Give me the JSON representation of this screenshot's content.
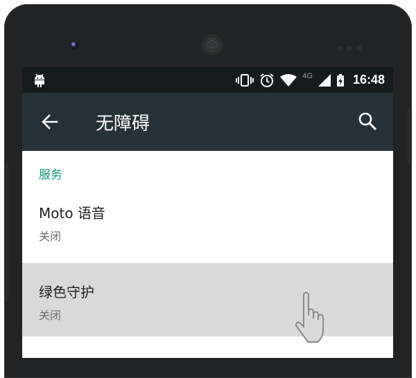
{
  "status_bar": {
    "network": "4G",
    "time": "16:48",
    "icons": [
      "android-icon",
      "vibrate-icon",
      "alarm-icon",
      "wifi-icon",
      "signal-icon",
      "battery-charging-icon"
    ]
  },
  "app_bar": {
    "title": "无障碍",
    "back_icon": "arrow-back-icon",
    "search_icon": "search-icon"
  },
  "section": {
    "header": "服务"
  },
  "items": [
    {
      "title": "Moto 语音",
      "subtitle": "关闭"
    },
    {
      "title": "绿色守护",
      "subtitle": "关闭"
    }
  ],
  "colors": {
    "status_bar": "#151a1d",
    "app_bar": "#263238",
    "accent": "#0e9a7e",
    "selected_row": "#d9d9d9"
  }
}
